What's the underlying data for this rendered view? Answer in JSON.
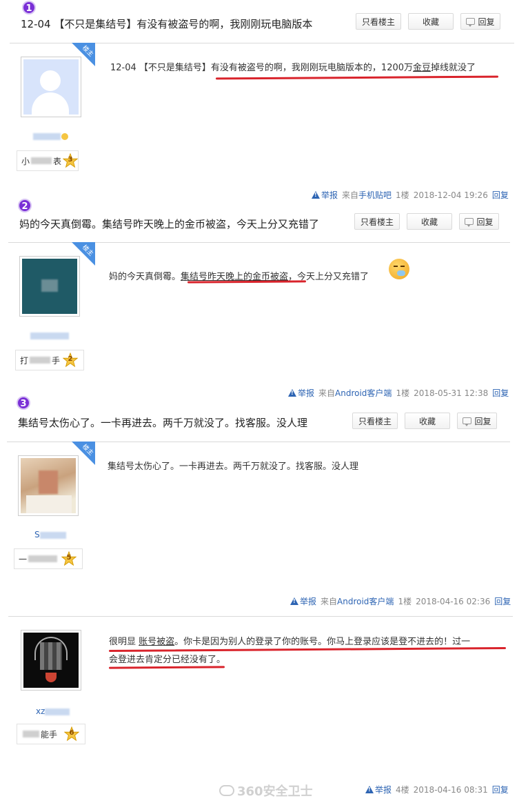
{
  "buttons": {
    "only_owner": "只看楼主",
    "favorite": "收藏",
    "reply": "回复"
  },
  "owner_tag": "楼主",
  "meta_common": {
    "report": "举报",
    "reply": "回复"
  },
  "threads": [
    {
      "badge": "1",
      "title": "12-04 【不只是集结号】有没有被盗号的啊，我刚刚玩电脑版本",
      "post": {
        "avatar": "default-avatar",
        "username": "",
        "level_name": "小",
        "level_suffix": "表",
        "level": "3",
        "content_prefix": "12-04 【不只是集结号】",
        "content_highlight": "有没有被盗号的啊，我刚刚玩电脑版本的，1200万",
        "content_under": "金豆",
        "content_tail": "掉线就没了",
        "source_prefix": "来自",
        "source": "手机贴吧",
        "floor": "1楼",
        "time": "2018-12-04 19:26"
      }
    },
    {
      "badge": "2",
      "title": "妈的今天真倒霉。集结号昨天晚上的金币被盗，今天上分又充错了",
      "post": {
        "avatar": "teal-avatar",
        "level_name": "打",
        "level_suffix": "手",
        "level": "2",
        "content_prefix": "妈的今天真倒霉。",
        "content_highlight": "集结号昨天晚上的",
        "content_under": "金币被盗",
        "content_tail": "，今天上分又充错了",
        "source_prefix": "来自",
        "source": "Android客户端",
        "floor": "1楼",
        "time": "2018-05-31 12:38"
      }
    },
    {
      "badge": "3",
      "title": "集结号太伤心了。一卡再进去。两千万就没了。找客服。没人理",
      "post": {
        "avatar": "photo-avatar",
        "username_prefix": "S",
        "level_name": "一",
        "level": "5",
        "content": "集结号太伤心了。一卡再进去。两千万就没了。找客服。没人理",
        "source_prefix": "来自",
        "source": "Android客户端",
        "floor": "1楼",
        "time": "2018-04-16 02:36"
      }
    }
  ],
  "reply_post": {
    "avatar": "dark-avatar",
    "username_prefix": "xz",
    "level_suffix": "能手",
    "level": "6",
    "content_line1_a": "很明显 ",
    "content_line1_u": "账号被盗",
    "content_line1_b": "。你卡是因为别人的登录了你的账号。你马上登录应该是登不进去的！过一",
    "content_line2": "会登进去肯定分已经没有了。",
    "floor": "4楼",
    "time": "2018-04-16 08:31"
  },
  "watermark": "360安全卫士",
  "colors": {
    "accent_link": "#2d64b3",
    "badge": "#7a2fd6",
    "underline_red": "#d9232b",
    "owner_tag": "#4a90e2"
  }
}
